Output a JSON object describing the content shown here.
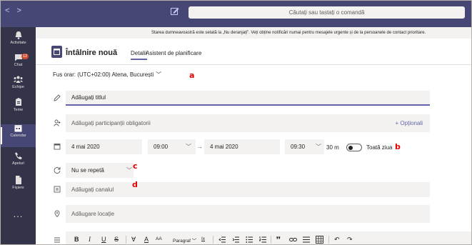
{
  "topbar": {
    "nav_back": "<",
    "nav_forward": ">",
    "search_placeholder": "Căutați sau tastați o comandă"
  },
  "rail": {
    "items": [
      {
        "label": "Activitate",
        "icon": "bell-icon"
      },
      {
        "label": "Chat",
        "icon": "chat-icon",
        "badge": "12"
      },
      {
        "label": "Echipe",
        "icon": "teams-icon"
      },
      {
        "label": "Teme",
        "icon": "assignments-icon"
      },
      {
        "label": "Calendar",
        "icon": "calendar-icon",
        "active": true
      },
      {
        "label": "Apeluri",
        "icon": "phone-icon"
      },
      {
        "label": "Fișiere",
        "icon": "files-icon"
      }
    ],
    "more": "..."
  },
  "dnd_banner": "Starea dumneavoastră este setată la „Nu deranjați”. Veți obține notificări numai pentru mesajele urgente și de la persoanele de contact prioritare.",
  "meeting": {
    "title": "Întâlnire nouă",
    "tab_details": "Detalii",
    "tab_assistant": "Asistent de planificare",
    "timezone": "Fus orar: (UTC+02:00) Atena, București",
    "title_placeholder": "Adăugați titlul",
    "attendees_placeholder": "Adăugați participanții obligatorii",
    "optional_link": "+ Opționali",
    "start_date": "4 mai 2020",
    "start_time": "09:00",
    "end_date": "4 mai 2020",
    "end_time": "09:30",
    "duration": "30 m",
    "all_day": "Toată ziua",
    "repeat": "Nu se repetă",
    "channel_placeholder": "Adăugați canalul",
    "location_placeholder": "Adăugare locație",
    "toolbar": {
      "bold": "B",
      "italic": "I",
      "underline": "U",
      "strike": "S",
      "highlight": "∀",
      "font_color": "A",
      "font_size": "AA",
      "paragraph": "Paragraf",
      "clear": "Ix",
      "undo": "↶",
      "redo": "↷"
    }
  },
  "annotations": [
    "a",
    "b",
    "c",
    "d"
  ],
  "colors": {
    "accent": "#6264a7",
    "topbar": "#464775",
    "rail": "#33344a",
    "annotation": "#e00000"
  }
}
